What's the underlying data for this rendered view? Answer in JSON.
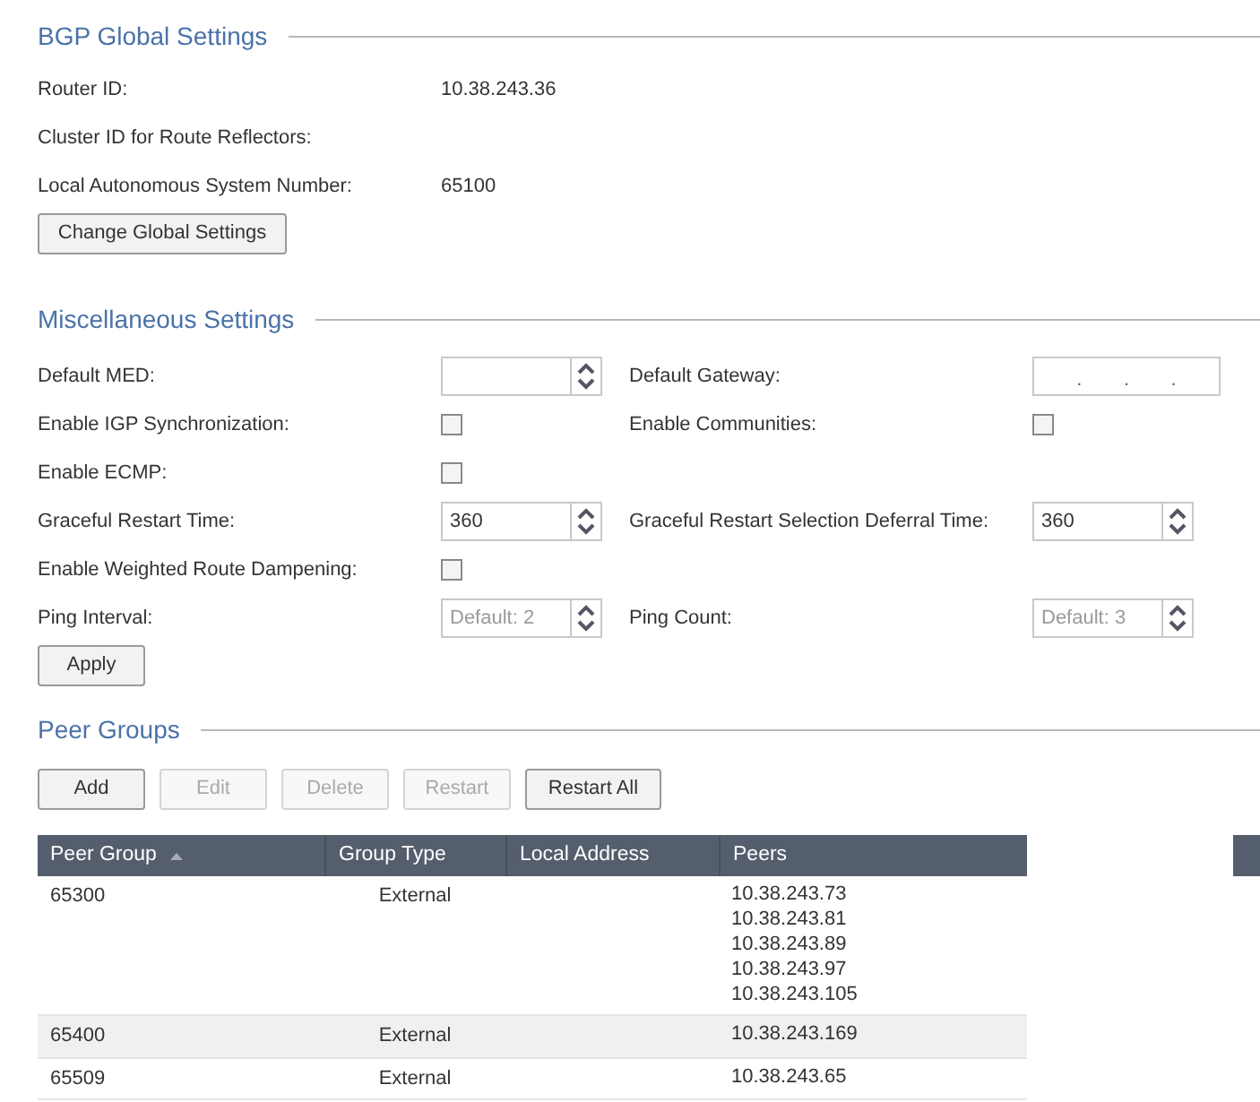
{
  "global_settings": {
    "title": "BGP Global Settings",
    "fields": [
      {
        "label": "Router ID:",
        "value": "10.38.243.36"
      },
      {
        "label": "Cluster ID for Route Reflectors:"
      },
      {
        "label": "Local Autonomous System Number:",
        "value": "65100"
      }
    ],
    "button": "Change Global Settings"
  },
  "misc_settings": {
    "title": "Miscellaneous Settings",
    "rows": [
      {
        "items": [
          {
            "kind": "spin",
            "label": "Default MED:"
          },
          {
            "kind": "ip",
            "label": "Default Gateway:",
            "separator": "."
          }
        ]
      },
      {
        "items": [
          {
            "kind": "checkbox",
            "label": "Enable IGP Synchronization:",
            "checked": false
          },
          {
            "kind": "checkbox",
            "label": "Enable Communities:",
            "checked": false
          }
        ]
      },
      {
        "items": [
          {
            "kind": "checkbox",
            "label": "Enable ECMP:",
            "checked": false
          }
        ]
      },
      {
        "items": [
          {
            "kind": "spin",
            "label": "Graceful Restart Time:",
            "value": "360"
          },
          {
            "kind": "spin",
            "label": "Graceful Restart Selection Deferral Time:",
            "value": "360"
          }
        ]
      },
      {
        "items": [
          {
            "kind": "checkbox",
            "label": "Enable Weighted Route Dampening:",
            "checked": false
          }
        ]
      },
      {
        "items": [
          {
            "kind": "spin",
            "label": "Ping Interval:",
            "placeholder": "Default: 2"
          },
          {
            "kind": "spin",
            "label": "Ping Count:",
            "placeholder": "Default: 3"
          }
        ]
      }
    ],
    "button": "Apply"
  },
  "peer_groups": {
    "title": "Peer Groups",
    "buttons": [
      {
        "label": "Add",
        "disabled": false
      },
      {
        "label": "Edit",
        "disabled": true
      },
      {
        "label": "Delete",
        "disabled": true
      },
      {
        "label": "Restart",
        "disabled": true
      },
      {
        "label": "Restart All",
        "disabled": false
      }
    ],
    "table": {
      "columns": [
        {
          "label": "Peer Group",
          "sorted": true
        },
        {
          "label": "Group Type"
        },
        {
          "label": "Local Address"
        },
        {
          "label": "Peers"
        }
      ],
      "rows": [
        {
          "peer_group": "65300",
          "group_type": "External",
          "peers": [
            "10.38.243.73",
            "10.38.243.81",
            "10.38.243.89",
            "10.38.243.97",
            "10.38.243.105"
          ]
        },
        {
          "peer_group": "65400",
          "group_type": "External",
          "peers": [
            "10.38.243.169"
          ]
        },
        {
          "peer_group": "65509",
          "group_type": "External",
          "peers": [
            "10.38.243.65"
          ]
        }
      ]
    }
  }
}
